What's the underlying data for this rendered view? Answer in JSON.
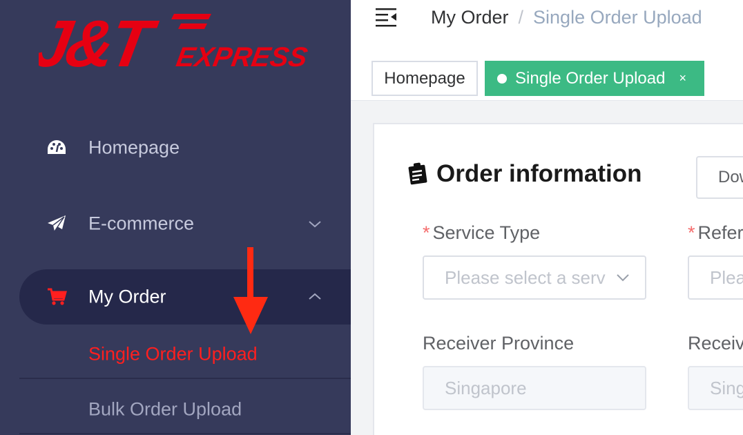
{
  "brand": {
    "logo_text": "J&T EXPRESS",
    "color": "#e60012"
  },
  "sidebar": {
    "items": [
      {
        "label": "Homepage",
        "icon": "dashboard-icon"
      },
      {
        "label": "E-commerce",
        "icon": "paper-plane-icon"
      },
      {
        "label": "My Order",
        "icon": "cart-icon"
      }
    ],
    "submenu": [
      {
        "label": "Single Order Upload"
      },
      {
        "label": "Bulk Order Upload"
      }
    ]
  },
  "header": {
    "breadcrumb": [
      "My Order",
      "Single Order Upload"
    ],
    "breadcrumb_separator": "/"
  },
  "tabs": [
    {
      "label": "Homepage"
    },
    {
      "label": "Single Order Upload",
      "close": "×"
    }
  ],
  "form": {
    "title": "Order information",
    "download_button": "Dow",
    "required_mark": "*",
    "fields": [
      {
        "label": "Service Type",
        "placeholder": "Please select a serv"
      },
      {
        "label": "Refer",
        "placeholder": "Plea"
      },
      {
        "label": "Receiver Province",
        "value": "Singapore"
      },
      {
        "label": "Receiv",
        "value": "Sing"
      }
    ]
  },
  "colors": {
    "sidebar_bg": "#363a5b",
    "active_bg": "#25284a",
    "accent_red": "#ff1f1f",
    "tab_green": "#3cba84"
  }
}
